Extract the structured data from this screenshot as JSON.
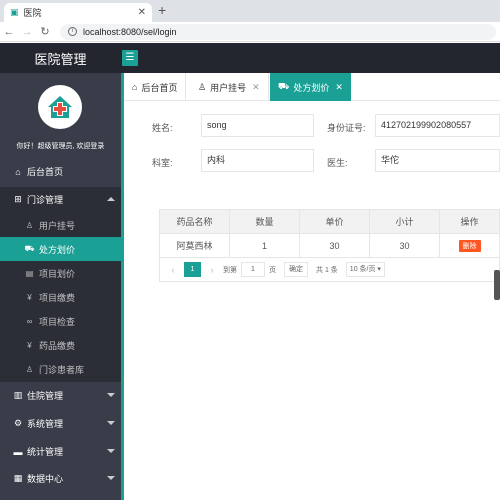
{
  "browser": {
    "tab_title": "医院",
    "url": "localhost:8080/sel/login"
  },
  "header": {
    "app_title": "医院管理",
    "menu_toggle": "☰"
  },
  "sidebar": {
    "greeting": "你好！超级管理员, 欢迎登录",
    "items": {
      "home": "后台首页",
      "outpatient": "门诊管理",
      "inpatient": "住院管理",
      "system": "系统管理",
      "stats": "统计管理",
      "data_center": "数据中心"
    },
    "sub_items": [
      {
        "label": "用户挂号",
        "icon": "user-icon"
      },
      {
        "label": "处方划价",
        "icon": "cart-icon"
      },
      {
        "label": "项目划价",
        "icon": "doc-icon"
      },
      {
        "label": "项目缴费",
        "icon": "yen-icon"
      },
      {
        "label": "项目检查",
        "icon": "link-icon"
      },
      {
        "label": "药品缴费",
        "icon": "yen-icon"
      },
      {
        "label": "门诊患者库",
        "icon": "user-icon"
      }
    ]
  },
  "content_tabs": [
    {
      "label": "后台首页",
      "icon": "home-icon"
    },
    {
      "label": "用户挂号",
      "icon": "user-icon"
    },
    {
      "label": "处方划价",
      "icon": "cart-icon"
    }
  ],
  "form": {
    "name_label": "姓名:",
    "name_value": "song",
    "id_label": "身份证号:",
    "id_value": "412702199902080557",
    "dept_label": "科室:",
    "dept_value": "内科",
    "doctor_label": "医生:",
    "doctor_value": "华佗"
  },
  "table": {
    "headers": [
      "药品名称",
      "数量",
      "单价",
      "小计",
      "操作"
    ],
    "rows": [
      {
        "name": "阿莫西林",
        "qty": "1",
        "price": "30",
        "subtotal": "30",
        "action": "删除"
      }
    ]
  },
  "pager": {
    "current": "1",
    "goto_label": "到第",
    "goto_value": "1",
    "page_unit": "页",
    "confirm": "确定",
    "total": "共 1 条",
    "per_page": "10 条/页"
  }
}
